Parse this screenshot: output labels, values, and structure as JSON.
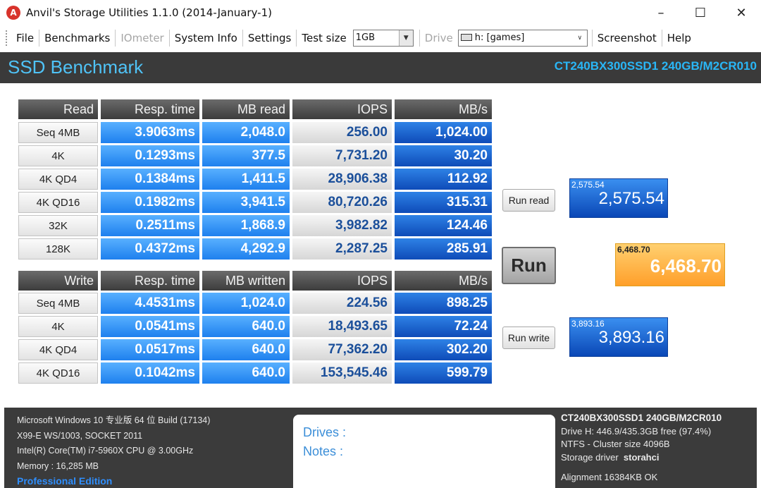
{
  "window": {
    "app_icon": "anvil-icon",
    "title": "Anvil's Storage Utilities 1.1.0 (2014-January-1)",
    "minimize": "–",
    "maximize": "☐",
    "close": "✕"
  },
  "menu": {
    "file": "File",
    "benchmarks": "Benchmarks",
    "iometer": "IOmeter",
    "system_info": "System Info",
    "settings": "Settings",
    "test_size_label": "Test size",
    "test_size_value": "1GB",
    "drive_label": "Drive",
    "drive_value": "h: [games]",
    "screenshot": "Screenshot",
    "help": "Help"
  },
  "header": {
    "title": "SSD Benchmark",
    "model": "CT240BX300SSD1 240GB/M2CR010"
  },
  "read": {
    "headers": [
      "Read",
      "Resp. time",
      "MB read",
      "IOPS",
      "MB/s"
    ],
    "rows": [
      {
        "label": "Seq 4MB",
        "resp": "3.9063ms",
        "mb": "2,048.0",
        "iops": "256.00",
        "mbs": "1,024.00"
      },
      {
        "label": "4K",
        "resp": "0.1293ms",
        "mb": "377.5",
        "iops": "7,731.20",
        "mbs": "30.20"
      },
      {
        "label": "4K QD4",
        "resp": "0.1384ms",
        "mb": "1,411.5",
        "iops": "28,906.38",
        "mbs": "112.92"
      },
      {
        "label": "4K QD16",
        "resp": "0.1982ms",
        "mb": "3,941.5",
        "iops": "80,720.26",
        "mbs": "315.31"
      },
      {
        "label": "32K",
        "resp": "0.2511ms",
        "mb": "1,868.9",
        "iops": "3,982.82",
        "mbs": "124.46"
      },
      {
        "label": "128K",
        "resp": "0.4372ms",
        "mb": "4,292.9",
        "iops": "2,287.25",
        "mbs": "285.91"
      }
    ]
  },
  "write": {
    "headers": [
      "Write",
      "Resp. time",
      "MB written",
      "IOPS",
      "MB/s"
    ],
    "rows": [
      {
        "label": "Seq 4MB",
        "resp": "4.4531ms",
        "mb": "1,024.0",
        "iops": "224.56",
        "mbs": "898.25"
      },
      {
        "label": "4K",
        "resp": "0.0541ms",
        "mb": "640.0",
        "iops": "18,493.65",
        "mbs": "72.24"
      },
      {
        "label": "4K QD4",
        "resp": "0.0517ms",
        "mb": "640.0",
        "iops": "77,362.20",
        "mbs": "302.20"
      },
      {
        "label": "4K QD16",
        "resp": "0.1042ms",
        "mb": "640.0",
        "iops": "153,545.46",
        "mbs": "599.79"
      }
    ]
  },
  "controls": {
    "run_read": "Run read",
    "run": "Run",
    "run_write": "Run write"
  },
  "scores": {
    "read_small": "2,575.54",
    "read": "2,575.54",
    "total_small": "6,468.70",
    "total": "6,468.70",
    "write_small": "3,893.16",
    "write": "3,893.16"
  },
  "footer": {
    "os": "Microsoft Windows 10 专业版 64 位 Build (17134)",
    "board": "X99-E WS/1003, SOCKET 2011",
    "cpu": "Intel(R) Core(TM) i7-5960X CPU @ 3.00GHz",
    "memory": "Memory : 16,285 MB",
    "edition": "Professional Edition",
    "drives_label": "Drives :",
    "notes_label": "Notes :",
    "drive_model": "CT240BX300SSD1 240GB/M2CR010",
    "drive_space": "Drive H: 446.9/435.3GB free (97.4%)",
    "cluster": "NTFS - Cluster size 4096B",
    "driver_label": "Storage driver",
    "driver_value": "storahci",
    "alignment": "Alignment 16384KB OK"
  },
  "colors": {
    "header_bg": "#3a3a3a",
    "accent_cyan": "#4fc3f7",
    "cell_blue_light": "#3d9cff",
    "cell_blue_dark": "#1560cc",
    "total_orange": "#ffb347"
  }
}
